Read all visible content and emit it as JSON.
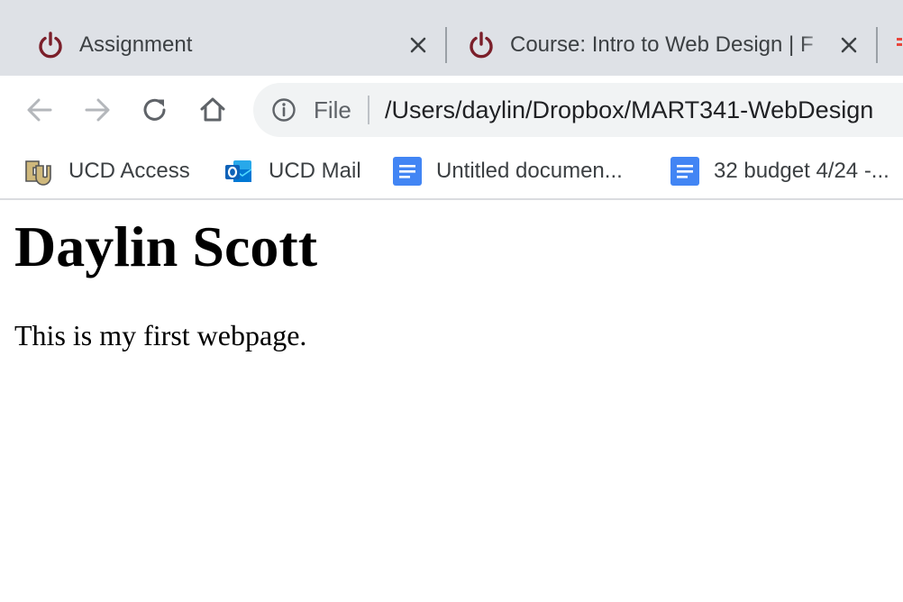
{
  "browser": {
    "tabs": [
      {
        "title": "Assignment",
        "favicon": "power-icon",
        "active": false
      },
      {
        "title": "Course: Intro to Web Design | F",
        "favicon": "power-icon",
        "active": false
      }
    ],
    "toolbar": {
      "back_icon": "arrow-left-icon",
      "forward_icon": "arrow-right-icon",
      "reload_icon": "reload-icon",
      "home_icon": "home-icon"
    },
    "omnibox": {
      "scheme_label": "File",
      "url": "/Users/daylin/Dropbox/MART341-WebDesign"
    },
    "bookmarks": [
      {
        "label": "UCD Access",
        "icon": "cu-logo-icon"
      },
      {
        "label": "UCD Mail",
        "icon": "outlook-icon"
      },
      {
        "label": "Untitled documen...",
        "icon": "google-docs-icon"
      },
      {
        "label": "32 budget 4/24 -...",
        "icon": "google-docs-icon"
      }
    ]
  },
  "page": {
    "heading": "Daylin Scott",
    "paragraph": "This is my first webpage."
  },
  "colors": {
    "tab_strip_bg": "#dee1e6",
    "favicon_red": "#7b1f2a",
    "omnibox_bg": "#f1f3f4",
    "docs_blue": "#4285f4",
    "outlook_blue": "#0f62b8"
  }
}
